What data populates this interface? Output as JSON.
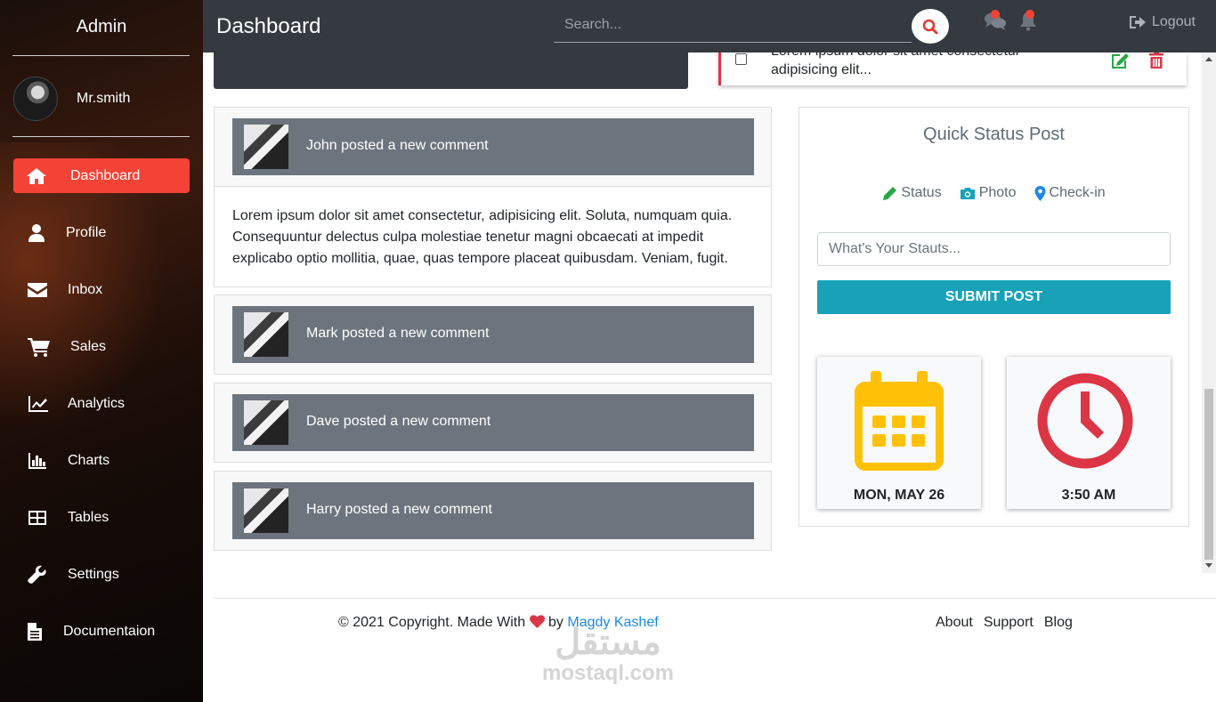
{
  "sidebar": {
    "brand": "Admin",
    "user_name": "Mr.smith",
    "items": [
      {
        "label": "Dashboard",
        "icon": "home-icon",
        "active": true
      },
      {
        "label": "Profile",
        "icon": "user-icon"
      },
      {
        "label": "Inbox",
        "icon": "envelope-icon"
      },
      {
        "label": "Sales",
        "icon": "cart-icon"
      },
      {
        "label": "Analytics",
        "icon": "line-chart-icon"
      },
      {
        "label": "Charts",
        "icon": "bar-chart-icon"
      },
      {
        "label": "Tables",
        "icon": "table-icon"
      },
      {
        "label": "Settings",
        "icon": "wrench-icon"
      },
      {
        "label": "Documentaion",
        "icon": "file-icon"
      }
    ]
  },
  "topbar": {
    "title": "Dashboard",
    "search_placeholder": "Search...",
    "logout_label": "Logout"
  },
  "todo": {
    "text_line1": "Lorem ipsum dolor sit amet consectetur",
    "text_line2": "adipisicing elit..."
  },
  "comments": [
    {
      "title": "John posted a new comment",
      "body": "Lorem ipsum dolor sit amet consectetur, adipisicing elit. Soluta, numquam quia. Consequuntur delectus culpa molestiae tenetur magni obcaecati at impedit explicabo optio mollitia, quae, quas tempore placeat quibusdam. Veniam, fugit."
    },
    {
      "title": "Mark posted a new comment"
    },
    {
      "title": "Dave posted a new comment"
    },
    {
      "title": "Harry posted a new comment"
    }
  ],
  "quick_status": {
    "title": "Quick Status Post",
    "tabs": [
      "Status",
      "Photo",
      "Check-in"
    ],
    "input_placeholder": "What's Your Stauts...",
    "submit_label": "SUBMIT POST",
    "date": "MON, MAY 26",
    "time": "3:50 AM"
  },
  "footer": {
    "copyright_prefix": "© 2021 Copyright. Made With",
    "by": "by",
    "author": "Magdy Kashef",
    "links": [
      "About",
      "Support",
      "Blog"
    ]
  },
  "watermark": {
    "arabic": "مستقل",
    "latin": "mostaql.com"
  },
  "colors": {
    "accent": "#f44336",
    "topbar": "#343a40",
    "submit": "#17a2b8",
    "calendar": "#ffc107",
    "clock": "#dc3545",
    "link": "#1e88e5"
  }
}
